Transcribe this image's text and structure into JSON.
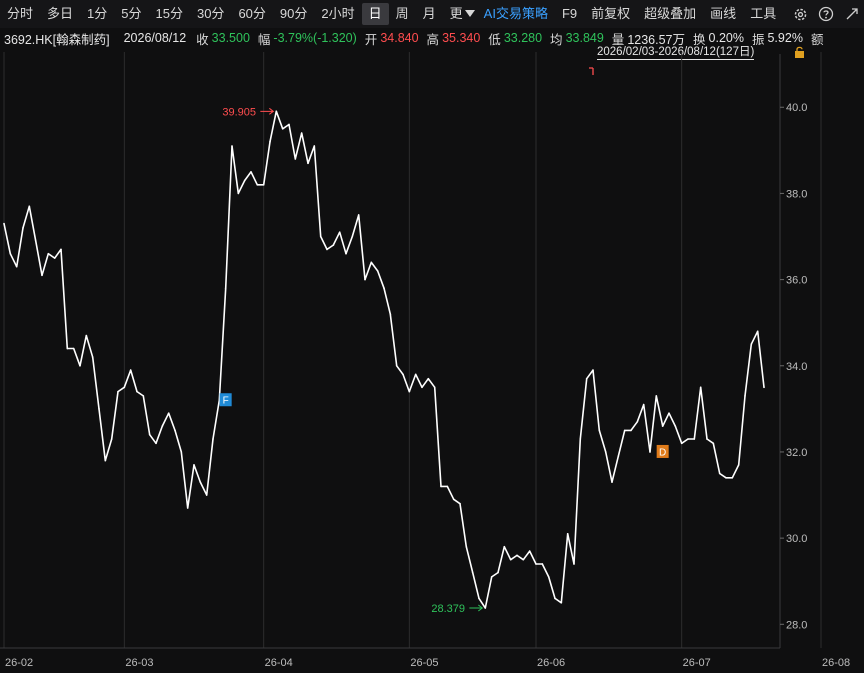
{
  "toolbar": {
    "items": [
      "分时",
      "多日",
      "1分",
      "5分",
      "15分",
      "30分",
      "60分",
      "90分",
      "2小时",
      "日",
      "周",
      "月",
      "更"
    ],
    "active_index": 9,
    "right_items": [
      "AI交易策略",
      "F9",
      "前复权",
      "超级叠加",
      "画线",
      "工具"
    ]
  },
  "quote": {
    "symbol": "3692.HK[翰森制药]",
    "date": "2026/08/12",
    "close_label": "收",
    "close": "33.500",
    "amp_label": "幅",
    "amp": "-3.79%(-1.320)",
    "open_label": "开",
    "open": "34.840",
    "high_label": "高",
    "high": "35.340",
    "low_label": "低",
    "low": "33.280",
    "avg_label": "均",
    "avg": "33.849",
    "vol_label": "量",
    "vol": "1236.57万",
    "turn_label": "换",
    "turn": "0.20%",
    "swing_label": "振",
    "swing": "5.92%",
    "amount_label": "额"
  },
  "range_label": "2026/02/03-2026/08/12(127日)",
  "colors": {
    "line": "#ffffff",
    "up": "#ff4d4f",
    "down": "#2fc25b",
    "marker_f": "#1f8ad6",
    "marker_d": "#e07b1a",
    "grid": "#2c2c2e"
  },
  "chart_data": {
    "type": "line",
    "x": [
      "2026-02-03",
      "2026-02-04",
      "2026-02-05",
      "2026-02-06",
      "2026-02-09",
      "2026-02-10",
      "2026-02-11",
      "2026-02-12",
      "2026-02-13",
      "2026-02-16",
      "2026-02-17",
      "2026-02-18",
      "2026-02-19",
      "2026-02-20",
      "2026-02-23",
      "2026-02-24",
      "2026-02-25",
      "2026-02-26",
      "2026-02-27",
      "2026-03-02",
      "2026-03-03",
      "2026-03-04",
      "2026-03-05",
      "2026-03-06",
      "2026-03-09",
      "2026-03-10",
      "2026-03-11",
      "2026-03-12",
      "2026-03-13",
      "2026-03-16",
      "2026-03-17",
      "2026-03-18",
      "2026-03-19",
      "2026-03-20",
      "2026-03-23",
      "2026-03-24",
      "2026-03-25",
      "2026-03-26",
      "2026-03-27",
      "2026-03-30",
      "2026-03-31",
      "2026-04-01",
      "2026-04-02",
      "2026-04-03",
      "2026-04-06",
      "2026-04-07",
      "2026-04-08",
      "2026-04-09",
      "2026-04-10",
      "2026-04-13",
      "2026-04-14",
      "2026-04-15",
      "2026-04-16",
      "2026-04-17",
      "2026-04-20",
      "2026-04-21",
      "2026-04-22",
      "2026-04-23",
      "2026-04-24",
      "2026-04-27",
      "2026-04-28",
      "2026-04-29",
      "2026-04-30",
      "2026-05-01",
      "2026-05-04",
      "2026-05-05",
      "2026-05-06",
      "2026-05-07",
      "2026-05-08",
      "2026-05-11",
      "2026-05-12",
      "2026-05-13",
      "2026-05-14",
      "2026-05-15",
      "2026-05-18",
      "2026-05-19",
      "2026-05-20",
      "2026-05-21",
      "2026-05-22",
      "2026-05-25",
      "2026-05-26",
      "2026-05-27",
      "2026-05-28",
      "2026-05-29",
      "2026-06-01",
      "2026-06-02",
      "2026-06-03",
      "2026-06-04",
      "2026-06-05",
      "2026-06-08",
      "2026-06-09",
      "2026-06-10",
      "2026-06-11",
      "2026-06-12",
      "2026-06-15",
      "2026-06-16",
      "2026-06-17",
      "2026-06-18",
      "2026-06-19",
      "2026-06-22",
      "2026-06-23",
      "2026-06-24",
      "2026-06-25",
      "2026-06-26",
      "2026-06-29",
      "2026-06-30",
      "2026-07-01",
      "2026-07-02",
      "2026-07-03",
      "2026-07-06",
      "2026-07-07",
      "2026-07-08",
      "2026-07-09",
      "2026-07-10",
      "2026-07-13",
      "2026-07-14",
      "2026-07-15",
      "2026-07-16",
      "2026-07-17",
      "2026-07-20",
      "2026-07-21",
      "2026-07-22",
      "2026-07-23",
      "2026-07-24",
      "2026-07-27",
      "2026-07-28",
      "2026-07-29",
      "2026-07-30",
      "2026-07-31",
      "2026-08-03",
      "2026-08-04",
      "2026-08-05",
      "2026-08-06",
      "2026-08-07",
      "2026-08-10",
      "2026-08-11",
      "2026-08-12"
    ],
    "values": [
      37.3,
      36.6,
      36.3,
      37.2,
      37.7,
      36.9,
      36.1,
      36.6,
      36.5,
      36.7,
      34.4,
      34.4,
      34.0,
      34.7,
      34.2,
      33.0,
      31.8,
      32.3,
      33.4,
      33.5,
      33.9,
      33.4,
      33.3,
      32.4,
      32.2,
      32.6,
      32.9,
      32.5,
      32.0,
      30.7,
      31.7,
      31.3,
      31.0,
      32.3,
      33.2,
      35.8,
      39.1,
      38.0,
      38.3,
      38.5,
      38.2,
      38.2,
      39.2,
      39.905,
      39.5,
      39.6,
      38.8,
      39.4,
      38.7,
      39.1,
      37.0,
      36.7,
      36.8,
      37.1,
      36.6,
      37.0,
      37.5,
      36.0,
      36.4,
      36.2,
      35.8,
      35.2,
      34.0,
      33.8,
      33.4,
      33.8,
      33.5,
      33.7,
      33.5,
      31.2,
      31.2,
      30.9,
      30.8,
      29.8,
      29.2,
      28.6,
      28.379,
      29.1,
      29.2,
      29.8,
      29.5,
      29.6,
      29.5,
      29.7,
      29.4,
      29.4,
      29.1,
      28.6,
      28.5,
      30.1,
      29.4,
      32.3,
      33.7,
      33.9,
      32.5,
      32.0,
      31.3,
      31.9,
      32.5,
      32.5,
      32.7,
      33.1,
      32.0,
      33.3,
      32.6,
      32.9,
      32.6,
      32.2,
      32.3,
      32.3,
      33.5,
      32.3,
      32.2,
      31.5,
      31.4,
      31.4,
      31.7,
      33.3,
      34.5,
      34.8,
      33.5
    ],
    "y_ticks": [
      28.0,
      30.0,
      32.0,
      34.0,
      36.0,
      38.0,
      40.0
    ],
    "y_tick_labels": [
      "28.0",
      "30.0",
      "32.0",
      "34.0",
      "36.0",
      "38.0",
      "40.0"
    ],
    "ylim": [
      27.45,
      41.05
    ],
    "x_tick_labels": [
      {
        "date": "2026-02-03",
        "label": "26-02"
      },
      {
        "date": "2026-03-02",
        "label": "26-03"
      },
      {
        "date": "2026-04-01",
        "label": "26-04"
      },
      {
        "date": "2026-05-04",
        "label": "26-05"
      },
      {
        "date": "2026-06-01",
        "label": "26-06"
      },
      {
        "date": "2026-07-02",
        "label": "26-07"
      },
      {
        "date": "2026-08-03",
        "label": "26-08"
      }
    ],
    "annotations": {
      "high": {
        "date": "2026-04-03",
        "value": 39.905,
        "label": "39.905"
      },
      "low": {
        "date": "2026-05-20",
        "value": 28.379,
        "label": "28.379"
      },
      "markers": [
        {
          "date": "2026-03-24",
          "value": 33.2,
          "label": "F"
        },
        {
          "date": "2026-06-29",
          "value": 32.0,
          "label": "D"
        }
      ]
    },
    "grid": true
  }
}
